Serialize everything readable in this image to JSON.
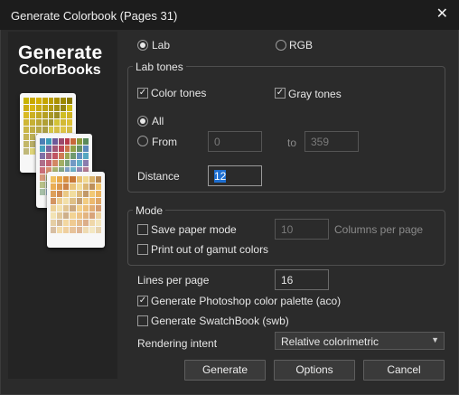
{
  "window": {
    "title": "Generate Colorbook (Pages 31)",
    "close_glyph": "✕"
  },
  "sidebar": {
    "logo_line1": "Generate",
    "logo_line2": "ColorBooks",
    "cards": [
      {
        "name": "yellow-swatch-card",
        "colors": [
          "#c8b400",
          "#c8a800",
          "#d4b000",
          "#c4a400",
          "#b89c00",
          "#aa9000",
          "#9c8800",
          "#8c7c00"
        ]
      },
      {
        "name": "multicolor-swatch-card",
        "colors": [
          "#4d7fb5",
          "#3a9ab8",
          "#6c5a9a",
          "#9a4a6c",
          "#b83a4a",
          "#c8683a",
          "#8a9a3a",
          "#5a8a5a"
        ]
      },
      {
        "name": "warm-swatch-card",
        "colors": [
          "#f0c060",
          "#e8a848",
          "#d89040",
          "#c87838",
          "#e8c070",
          "#f0d890",
          "#d8b068",
          "#b88850"
        ]
      }
    ]
  },
  "color_space": {
    "lab_label": "Lab",
    "rgb_label": "RGB",
    "selected": "Lab"
  },
  "lab_tones": {
    "legend": "Lab tones",
    "color_tones_label": "Color tones",
    "gray_tones_label": "Gray tones",
    "color_tones_checked": true,
    "gray_tones_checked": true,
    "all_label": "All",
    "from_label": "From",
    "to_label": "to",
    "from_value": "0",
    "to_value": "359",
    "distance_label": "Distance",
    "distance_value": "12",
    "check_glyph": "✓"
  },
  "mode": {
    "legend": "Mode",
    "save_paper_label": "Save paper mode",
    "columns_value": "10",
    "columns_label": "Columns per page",
    "gamut_label": "Print out of gamut colors"
  },
  "options": {
    "lines_label": "Lines per page",
    "lines_value": "16",
    "aco_label": "Generate Photoshop color palette (aco)",
    "swb_label": "Generate SwatchBook (swb)",
    "rendering_label": "Rendering intent",
    "rendering_value": "Relative colorimetric",
    "caret_glyph": "▼"
  },
  "buttons": {
    "generate": "Generate",
    "options": "Options",
    "cancel": "Cancel"
  }
}
